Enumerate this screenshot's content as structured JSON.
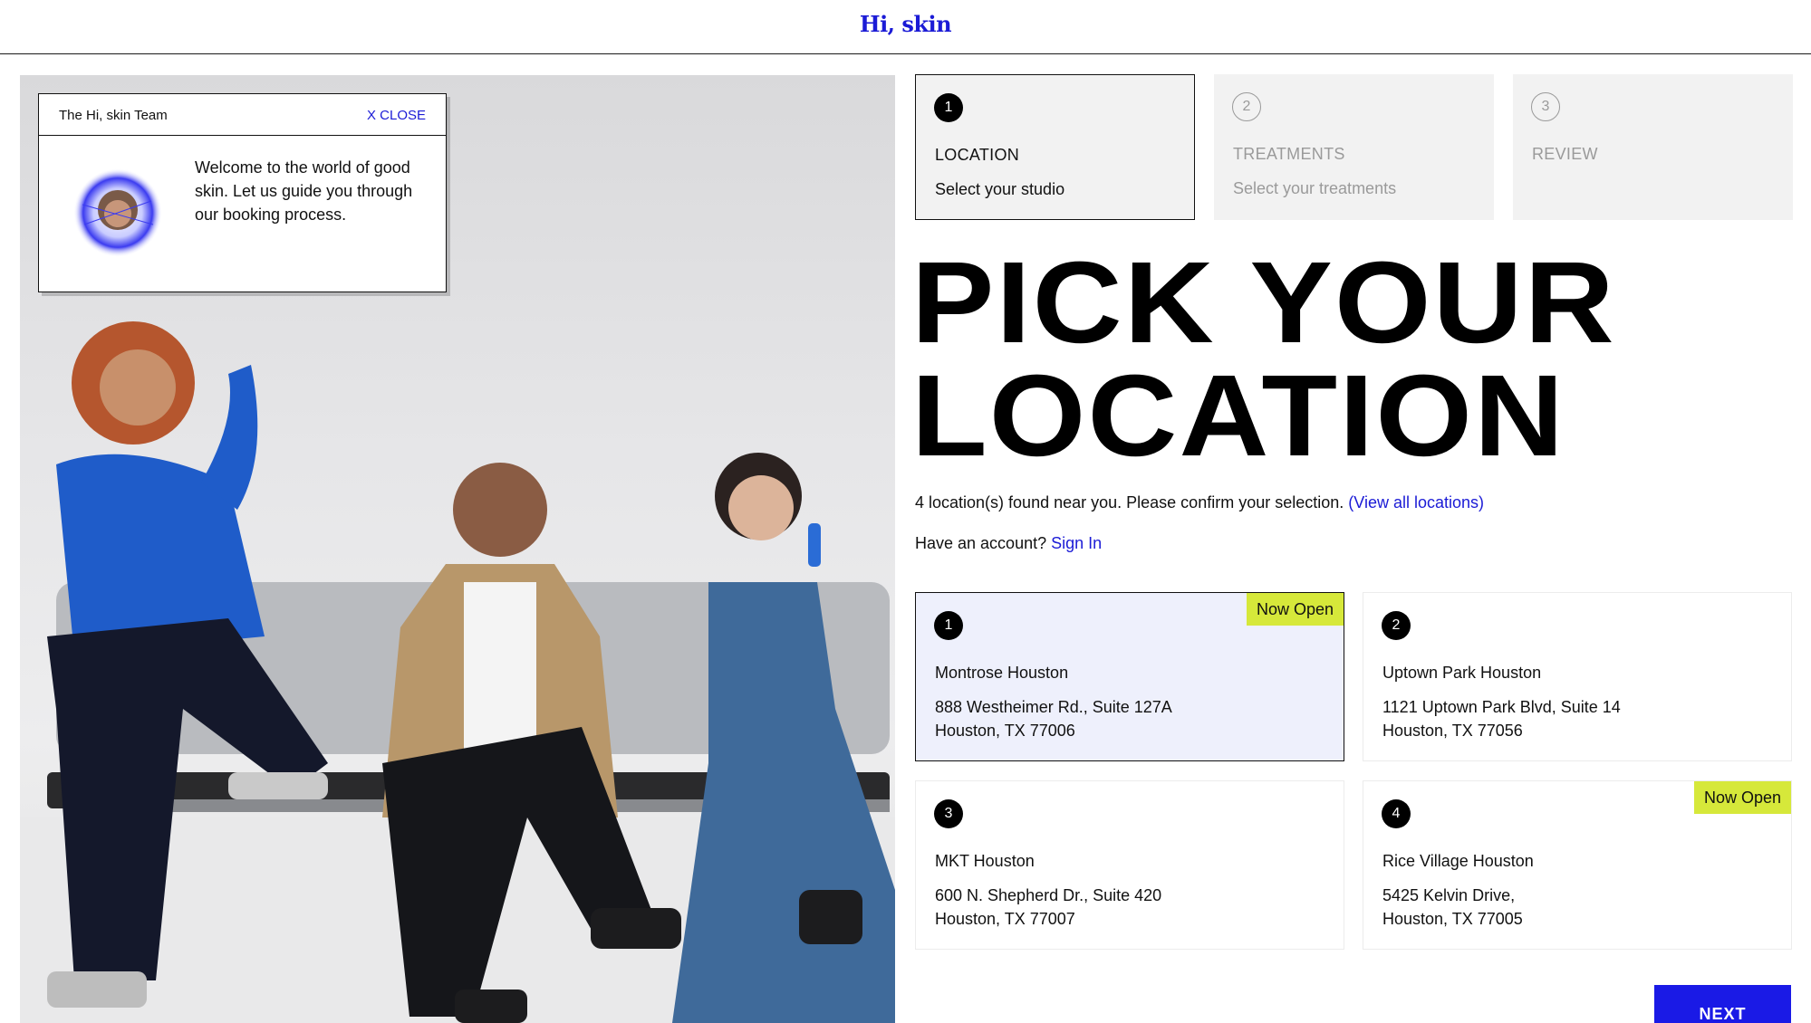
{
  "header": {
    "logo": "Hi, skin"
  },
  "popup": {
    "team": "The Hi, skin Team",
    "close": "X CLOSE",
    "message": "Welcome to the world of good skin. Let us guide you through our booking process."
  },
  "steps": [
    {
      "num": "1",
      "title": "LOCATION",
      "subtitle": "Select your studio",
      "state": "active"
    },
    {
      "num": "2",
      "title": "TREATMENTS",
      "subtitle": "Select your treatments",
      "state": "inactive"
    },
    {
      "num": "3",
      "title": "REVIEW",
      "subtitle": "",
      "state": "inactive"
    }
  ],
  "headline": {
    "line1": "PICK YOUR",
    "line2": "LOCATION"
  },
  "found": {
    "text": "4 location(s) found near you. Please confirm your selection.",
    "link": "(View all locations)"
  },
  "account": {
    "text": "Have an account?",
    "link": "Sign In"
  },
  "locations": [
    {
      "num": "1",
      "name": "Montrose Houston",
      "addr1": "888 Westheimer Rd., Suite 127A",
      "addr2": "Houston, TX 77006",
      "badge": "Now Open",
      "selected": true
    },
    {
      "num": "2",
      "name": "Uptown Park Houston",
      "addr1": "1121 Uptown Park Blvd, Suite 14",
      "addr2": "Houston, TX 77056",
      "badge": "",
      "selected": false
    },
    {
      "num": "3",
      "name": "MKT Houston",
      "addr1": "600 N. Shepherd Dr., Suite 420",
      "addr2": "Houston, TX 77007",
      "badge": "",
      "selected": false
    },
    {
      "num": "4",
      "name": "Rice Village Houston",
      "addr1": "5425 Kelvin Drive,",
      "addr2": "Houston, TX 77005",
      "badge": "Now Open",
      "selected": false
    }
  ],
  "next_label": "NEXT",
  "colors": {
    "accent_blue": "#1b1bd6",
    "badge_lime": "#d6e83a",
    "selected_card": "#eef0fc"
  }
}
